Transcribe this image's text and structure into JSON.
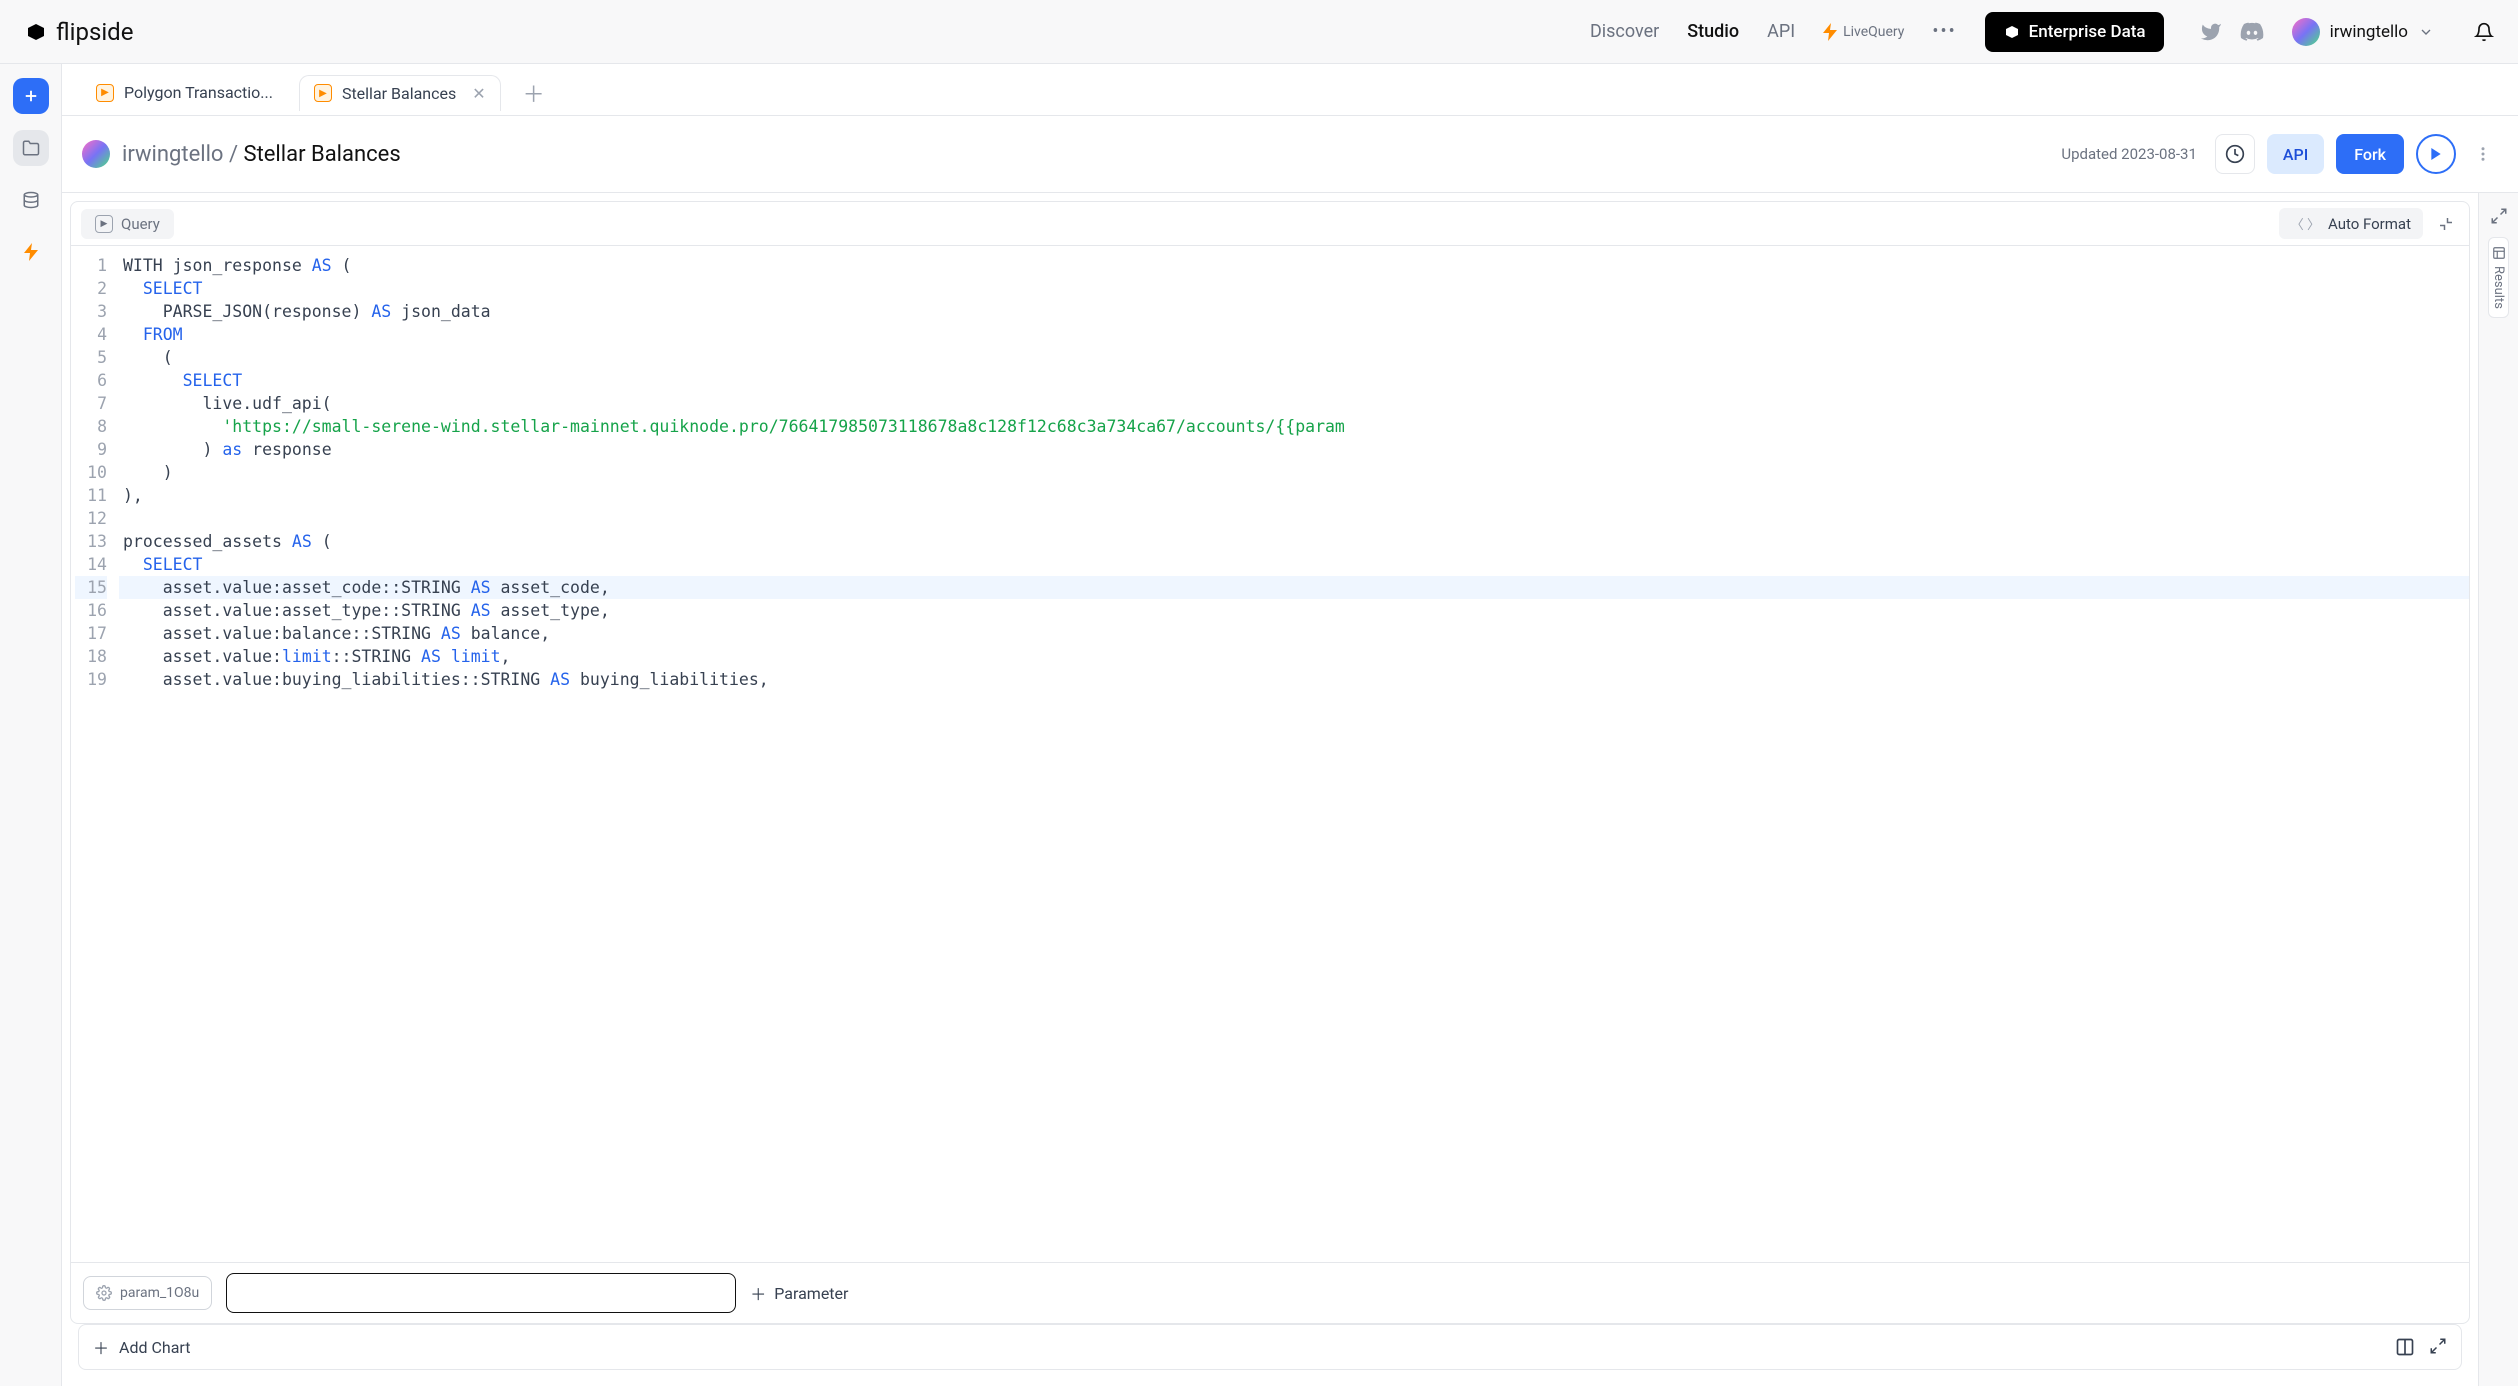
{
  "brand": "flipside",
  "nav": {
    "discover": "Discover",
    "studio": "Studio",
    "api": "API",
    "livequery": "LiveQuery",
    "enterprise": "Enterprise Data"
  },
  "user": {
    "name": "irwingtello"
  },
  "tabs": [
    {
      "label": "Polygon Transactio..."
    },
    {
      "label": "Stellar Balances"
    }
  ],
  "breadcrumb": {
    "owner": "irwingtello",
    "sep": "/",
    "title": "Stellar Balances"
  },
  "meta": {
    "updated": "Updated 2023-08-31"
  },
  "buttons": {
    "api": "API",
    "fork": "Fork",
    "autoformat": "Auto Format",
    "query_tab": "Query",
    "add_param": "Parameter",
    "add_chart": "Add Chart"
  },
  "param": {
    "name": "param_1O8u",
    "value": ""
  },
  "right_rail": {
    "results": "Results"
  },
  "code_lines": [
    {
      "n": 1,
      "highlight": false
    },
    {
      "n": 2,
      "highlight": false
    },
    {
      "n": 3,
      "highlight": false
    },
    {
      "n": 4,
      "highlight": false
    },
    {
      "n": 5,
      "highlight": false
    },
    {
      "n": 6,
      "highlight": false
    },
    {
      "n": 7,
      "highlight": false
    },
    {
      "n": 8,
      "highlight": false
    },
    {
      "n": 9,
      "highlight": false
    },
    {
      "n": 10,
      "highlight": false
    },
    {
      "n": 11,
      "highlight": false
    },
    {
      "n": 12,
      "highlight": false
    },
    {
      "n": 13,
      "highlight": false
    },
    {
      "n": 14,
      "highlight": false
    },
    {
      "n": 15,
      "highlight": true
    },
    {
      "n": 16,
      "highlight": false
    },
    {
      "n": 17,
      "highlight": false
    },
    {
      "n": 18,
      "highlight": false
    },
    {
      "n": 19,
      "highlight": false
    }
  ],
  "code_tokens": {
    "l1": [
      [
        "txt",
        "WITH json_response "
      ],
      [
        "kw",
        "AS"
      ],
      [
        "txt",
        " ("
      ]
    ],
    "l2": [
      [
        "txt",
        "  "
      ],
      [
        "kw",
        "SELECT"
      ]
    ],
    "l3": [
      [
        "txt",
        "    PARSE_JSON(response) "
      ],
      [
        "kw",
        "AS"
      ],
      [
        "txt",
        " json_data"
      ]
    ],
    "l4": [
      [
        "txt",
        "  "
      ],
      [
        "kw",
        "FROM"
      ]
    ],
    "l5": [
      [
        "txt",
        "    ("
      ]
    ],
    "l6": [
      [
        "txt",
        "      "
      ],
      [
        "kw",
        "SELECT"
      ]
    ],
    "l7": [
      [
        "txt",
        "        live.udf_api("
      ]
    ],
    "l8": [
      [
        "txt",
        "          "
      ],
      [
        "str",
        "'https://small-serene-wind.stellar-mainnet.quiknode.pro/766417985073118678a8c128f12c68c3a734ca67/accounts/{{param"
      ]
    ],
    "l9": [
      [
        "txt",
        "        ) "
      ],
      [
        "kw",
        "as"
      ],
      [
        "txt",
        " response"
      ]
    ],
    "l10": [
      [
        "txt",
        "    )"
      ]
    ],
    "l11": [
      [
        "txt",
        "),"
      ]
    ],
    "l12": [
      [
        "txt",
        ""
      ]
    ],
    "l13": [
      [
        "txt",
        "processed_assets "
      ],
      [
        "kw",
        "AS"
      ],
      [
        "txt",
        " ("
      ]
    ],
    "l14": [
      [
        "txt",
        "  "
      ],
      [
        "kw",
        "SELECT"
      ]
    ],
    "l15": [
      [
        "txt",
        "    asset.value:asset_code::STRING "
      ],
      [
        "kw",
        "AS"
      ],
      [
        "txt",
        " asset_code,"
      ]
    ],
    "l16": [
      [
        "txt",
        "    asset.value:asset_type::STRING "
      ],
      [
        "kw",
        "AS"
      ],
      [
        "txt",
        " asset_type,"
      ]
    ],
    "l17": [
      [
        "txt",
        "    asset.value:balance::STRING "
      ],
      [
        "kw",
        "AS"
      ],
      [
        "txt",
        " balance,"
      ]
    ],
    "l18": [
      [
        "txt",
        "    asset.value:"
      ],
      [
        "kw",
        "limit"
      ],
      [
        "txt",
        "::STRING "
      ],
      [
        "kw",
        "AS"
      ],
      [
        "txt",
        " "
      ],
      [
        "kw",
        "limit"
      ],
      [
        "txt",
        ","
      ]
    ],
    "l19": [
      [
        "txt",
        "    asset.value:buying_liabilities::STRING "
      ],
      [
        "kw",
        "AS"
      ],
      [
        "txt",
        " buying_liabilities,"
      ]
    ]
  }
}
